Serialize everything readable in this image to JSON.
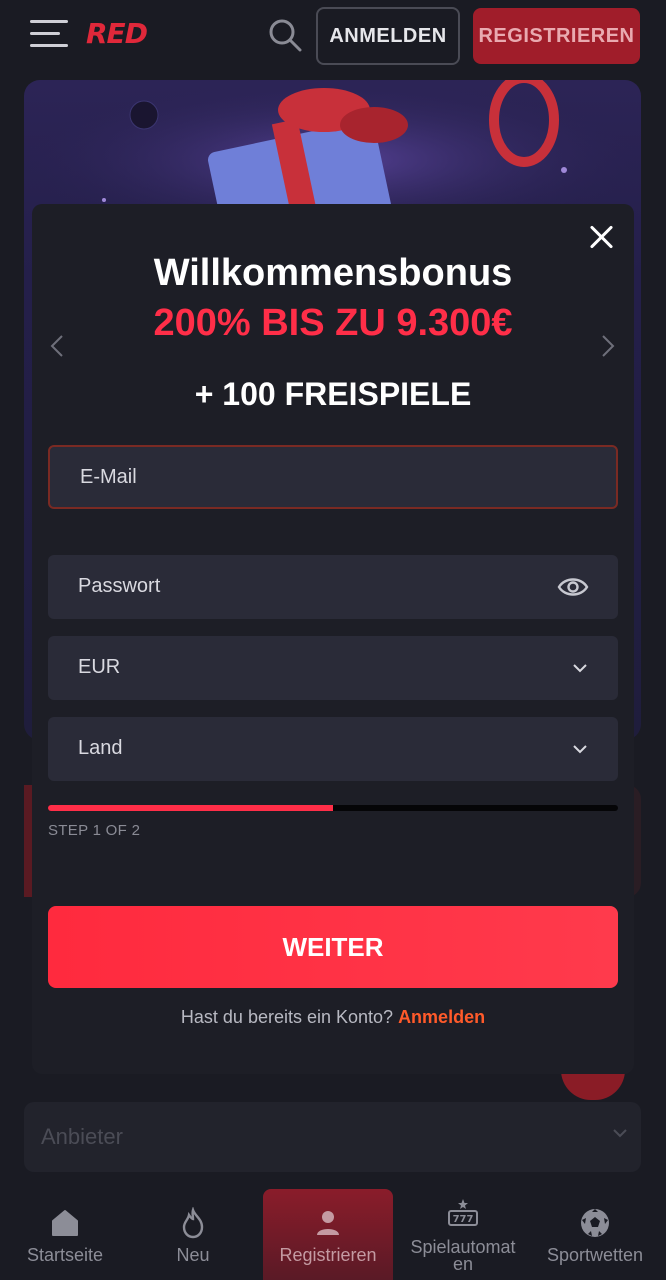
{
  "header": {
    "logo_text": "RED",
    "login_label": "ANMELDEN",
    "register_label": "REGISTRIEREN"
  },
  "modal": {
    "title": "Willkommensbonus",
    "subtitle": "200% BIS ZU 9.300€",
    "free_spins": "+ 100 FREISPIELE",
    "email_placeholder": "E-Mail",
    "password_label": "Passwort",
    "currency_value": "EUR",
    "country_label": "Land",
    "progress_fraction": 0.5,
    "step_text": "STEP 1 OF 2",
    "continue_label": "WEITER",
    "account_question": "Hast du bereits ein Konto?",
    "account_link": "Anmelden"
  },
  "background": {
    "provider_label": "Anbieter"
  },
  "bottom_nav": {
    "items": [
      {
        "label": "Startseite",
        "icon": "home-icon"
      },
      {
        "label": "Neu",
        "icon": "flame-icon"
      },
      {
        "label": "Registrieren",
        "icon": "user-icon",
        "active": true
      },
      {
        "label": "Spielautomat\nen",
        "icon": "slot-machine-icon"
      },
      {
        "label": "Sportwetten",
        "icon": "soccer-ball-icon"
      }
    ]
  },
  "colors": {
    "accent": "#ff2e48",
    "link": "#ff5a2a",
    "background": "#1a1b23",
    "modal": "#1d1e26",
    "field": "#2a2b38"
  }
}
